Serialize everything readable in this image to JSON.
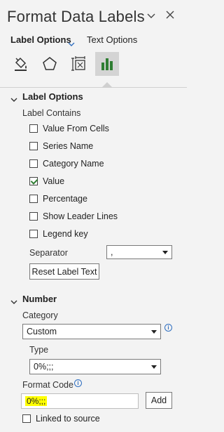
{
  "pane": {
    "title": "Format Data Labels",
    "tabs": [
      {
        "label": "Label Options"
      },
      {
        "label": "Text Options"
      }
    ]
  },
  "icons": {
    "fill_line": "paint-bucket-icon",
    "effects": "pentagon-icon",
    "size_properties": "size-properties-icon",
    "label_options": "bar-chart-icon"
  },
  "label_options": {
    "header": "Label Options",
    "contains_label": "Label Contains",
    "checkboxes": [
      {
        "label": "Value From Cells",
        "checked": false
      },
      {
        "label": "Series Name",
        "checked": false
      },
      {
        "label": "Category Name",
        "checked": false
      },
      {
        "label": "Value",
        "checked": true
      },
      {
        "label": "Percentage",
        "checked": false
      },
      {
        "label": "Show Leader Lines",
        "checked": false
      },
      {
        "label": "Legend key",
        "checked": false
      }
    ],
    "separator_label": "Separator",
    "separator_value": ",",
    "reset_label": "Reset Label Text"
  },
  "number": {
    "header": "Number",
    "category_label": "Category",
    "category_value": "Custom",
    "type_label": "Type",
    "type_value": "0%;;;",
    "format_code_label": "Format Code",
    "format_code_value": "0%;;;",
    "add_label": "Add",
    "linked_label": "Linked to source",
    "linked_checked": false
  },
  "colors": {
    "accent": "#2f6fc0",
    "selected_tab_bg": "#d4d4d4",
    "highlight": "#ffff00",
    "checkmark": "#2e7d32"
  }
}
